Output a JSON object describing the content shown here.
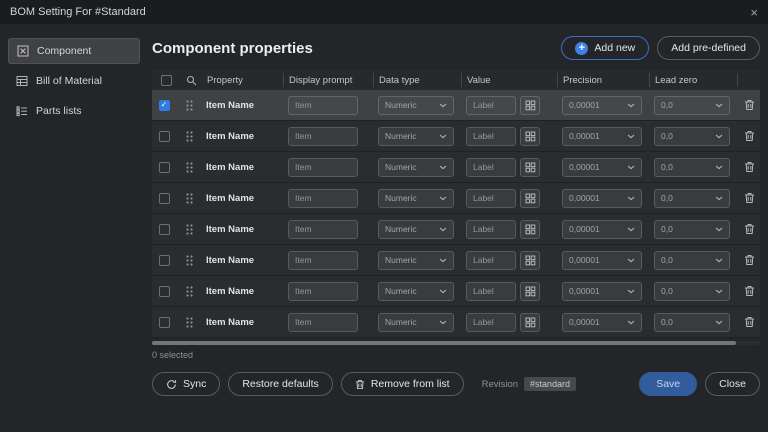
{
  "dialog": {
    "title": "BOM Setting For #Standard",
    "close_glyph": "×"
  },
  "sidebar": {
    "items": [
      {
        "label": "Component"
      },
      {
        "label": "Bill of Material"
      },
      {
        "label": "Parts lists"
      }
    ]
  },
  "header": {
    "title": "Component properties",
    "add_new_label": "Add new",
    "add_predefined_label": "Add pre-defined"
  },
  "table": {
    "columns": [
      "Property",
      "Display prompt",
      "Data type",
      "Value",
      "Precision",
      "Lead zero"
    ],
    "rows": [
      {
        "property": "Item Name",
        "display_prompt_placeholder": "Item",
        "data_type": "Numeric",
        "value_placeholder": "Label",
        "precision": "0,00001",
        "lead_zero": "0,0",
        "selected": true,
        "checked": true
      },
      {
        "property": "Item Name",
        "display_prompt_placeholder": "Item",
        "data_type": "Numeric",
        "value_placeholder": "Label",
        "precision": "0,00001",
        "lead_zero": "0,0",
        "selected": false,
        "checked": false
      },
      {
        "property": "Item Name",
        "display_prompt_placeholder": "Item",
        "data_type": "Numeric",
        "value_placeholder": "Label",
        "precision": "0,00001",
        "lead_zero": "0,0",
        "selected": false,
        "checked": false
      },
      {
        "property": "Item Name",
        "display_prompt_placeholder": "Item",
        "data_type": "Numeric",
        "value_placeholder": "Label",
        "precision": "0,00001",
        "lead_zero": "0,0",
        "selected": false,
        "checked": false
      },
      {
        "property": "Item Name",
        "display_prompt_placeholder": "Item",
        "data_type": "Numeric",
        "value_placeholder": "Label",
        "precision": "0,00001",
        "lead_zero": "0,0",
        "selected": false,
        "checked": false
      },
      {
        "property": "Item Name",
        "display_prompt_placeholder": "Item",
        "data_type": "Numeric",
        "value_placeholder": "Label",
        "precision": "0,00001",
        "lead_zero": "0,0",
        "selected": false,
        "checked": false
      },
      {
        "property": "Item Name",
        "display_prompt_placeholder": "Item",
        "data_type": "Numeric",
        "value_placeholder": "Label",
        "precision": "0,00001",
        "lead_zero": "0,0",
        "selected": false,
        "checked": false
      },
      {
        "property": "Item Name",
        "display_prompt_placeholder": "Item",
        "data_type": "Numeric",
        "value_placeholder": "Label",
        "precision": "0,00001",
        "lead_zero": "0,0",
        "selected": false,
        "checked": false
      }
    ],
    "selected_count_label": "0 selected"
  },
  "footer": {
    "sync_label": "Sync",
    "restore_defaults_label": "Restore defaults",
    "remove_from_list_label": "Remove from list",
    "revision_label": "Revision",
    "revision_value": "#standard",
    "save_label": "Save",
    "close_label": "Close"
  },
  "colors": {
    "accent_blue": "#3c80e8",
    "save_button_bg": "#315d9d",
    "selected_row_bg": "#404144"
  }
}
